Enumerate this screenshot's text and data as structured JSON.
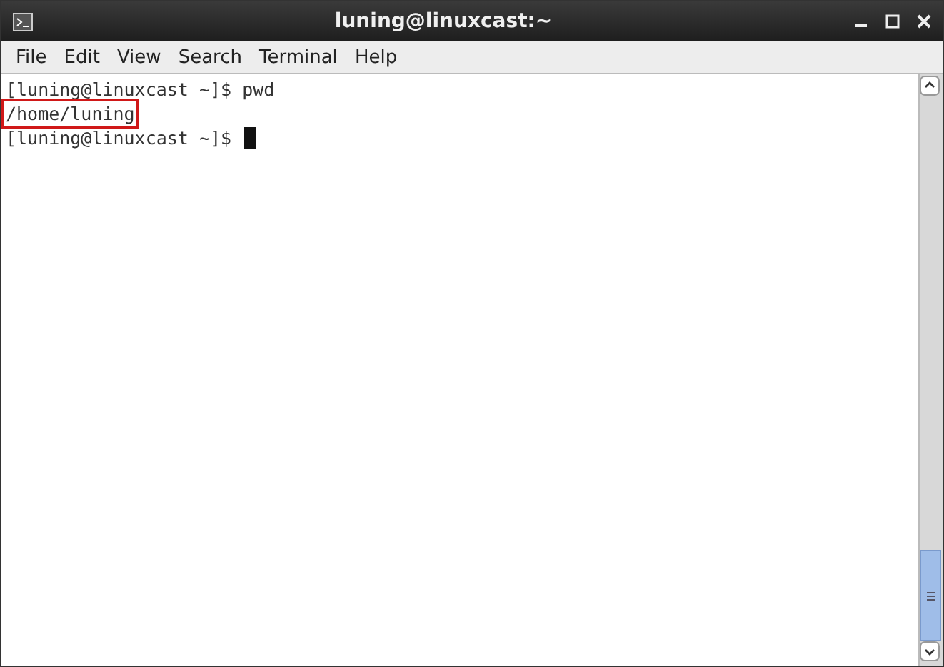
{
  "window": {
    "title": "luning@linuxcast:~"
  },
  "menu": [
    "File",
    "Edit",
    "View",
    "Search",
    "Terminal",
    "Help"
  ],
  "terminal": {
    "lines": [
      {
        "text": "[luning@linuxcast ~]$ pwd",
        "highlighted": false,
        "cursor": false
      },
      {
        "text": "/home/luning",
        "highlighted": true,
        "cursor": false
      },
      {
        "text": "[luning@linuxcast ~]$ ",
        "highlighted": false,
        "cursor": true
      }
    ]
  }
}
